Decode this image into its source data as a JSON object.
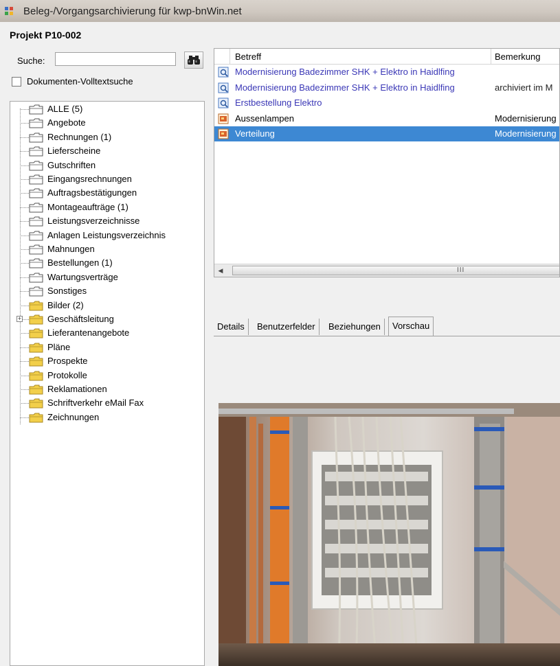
{
  "window": {
    "title": "Beleg-/Vorgangsarchivierung für kwp-bnWin.net"
  },
  "project": {
    "label": "Projekt P10-002"
  },
  "search": {
    "label": "Suche:",
    "value": "",
    "fulltext_label": "Dokumenten-Volltextsuche",
    "fulltext_checked": false
  },
  "tree": {
    "items": [
      {
        "label": "ALLE (5)"
      },
      {
        "label": "Angebote"
      },
      {
        "label": "Rechnungen (1)"
      },
      {
        "label": "Lieferscheine"
      },
      {
        "label": "Gutschriften"
      },
      {
        "label": "Eingangsrechnungen"
      },
      {
        "label": "Auftragsbestätigungen"
      },
      {
        "label": "Montageaufträge (1)"
      },
      {
        "label": "Leistungsverzeichnisse"
      },
      {
        "label": "Anlagen Leistungsverzeichnis"
      },
      {
        "label": "Mahnungen"
      },
      {
        "label": "Bestellungen (1)"
      },
      {
        "label": "Wartungsverträge"
      },
      {
        "label": "Sonstiges"
      },
      {
        "label": "Bilder (2)"
      },
      {
        "label": "Geschäftsleitung"
      },
      {
        "label": "Lieferantenangebote"
      },
      {
        "label": "Pläne"
      },
      {
        "label": "Prospekte"
      },
      {
        "label": "Protokolle"
      },
      {
        "label": "Reklamationen"
      },
      {
        "label": "Schriftverkehr eMail Fax"
      },
      {
        "label": "Zeichnungen"
      }
    ]
  },
  "table": {
    "columns": [
      "Betreff",
      "Bemerkung"
    ],
    "rows": [
      {
        "betreff": "Modernisierung Badezimmer SHK + Elektro in Haidlfing",
        "bemerkung": ""
      },
      {
        "betreff": "Modernisierung Badezimmer SHK + Elektro in Haidlfing",
        "bemerkung": "archiviert im M"
      },
      {
        "betreff": "Erstbestellung Elektro",
        "bemerkung": ""
      },
      {
        "betreff": "Aussenlampen",
        "bemerkung": "Modernisierung"
      },
      {
        "betreff": "Verteilung",
        "bemerkung": "Modernisierung"
      }
    ],
    "scroll_grip": "III"
  },
  "tabs": [
    "Details",
    "Benutzerfelder",
    "Beziehungen",
    "Vorschau"
  ],
  "colors": {
    "selection": "#3d88d3",
    "link": "#3a37b6",
    "folder": "#f2cf4a"
  }
}
